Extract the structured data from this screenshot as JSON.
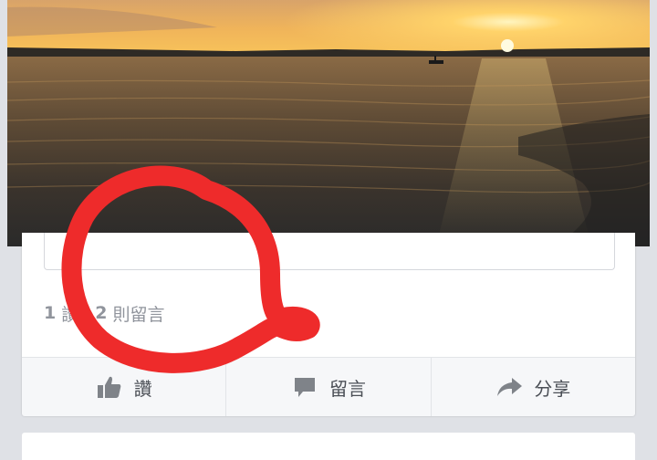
{
  "post": {
    "like_count": "1",
    "like_count_label": "讚",
    "comment_count": "2",
    "comment_count_label": "則留言"
  },
  "actions": {
    "like_label": "讚",
    "comment_label": "留言",
    "share_label": "分享"
  },
  "icons": {
    "like": "thumbs-up-icon",
    "comment": "comment-bubble-icon",
    "share": "share-arrow-icon"
  },
  "colors": {
    "annotation": "#ee2b2b",
    "action_text": "#4b4f56",
    "count_text": "#90949c"
  }
}
